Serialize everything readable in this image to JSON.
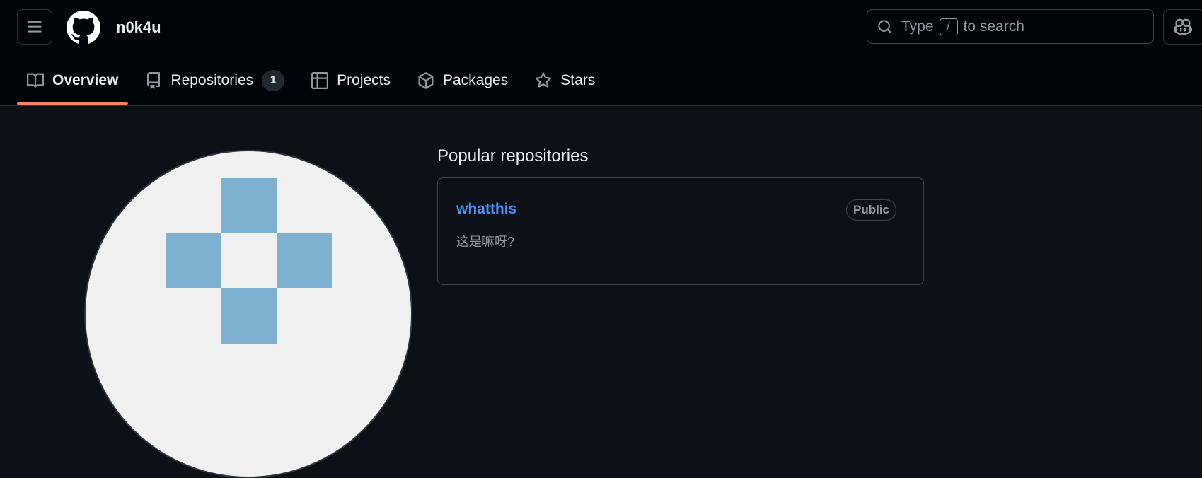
{
  "header": {
    "username": "n0k4u",
    "search": {
      "prefix": "Type",
      "key": "/",
      "suffix": "to search"
    }
  },
  "tabs": [
    {
      "label": "Overview",
      "icon": "book-icon",
      "active": true
    },
    {
      "label": "Repositories",
      "icon": "repo-icon",
      "count": "1"
    },
    {
      "label": "Projects",
      "icon": "table-icon"
    },
    {
      "label": "Packages",
      "icon": "package-icon"
    },
    {
      "label": "Stars",
      "icon": "star-icon"
    }
  ],
  "popular": {
    "title": "Popular repositories",
    "repos": [
      {
        "name": "whatthis",
        "visibility": "Public",
        "description": "这是嘛呀?"
      }
    ]
  },
  "colors": {
    "accent": "#f78166",
    "link": "#4493f8",
    "avatar_block": "#7eb1d1"
  }
}
